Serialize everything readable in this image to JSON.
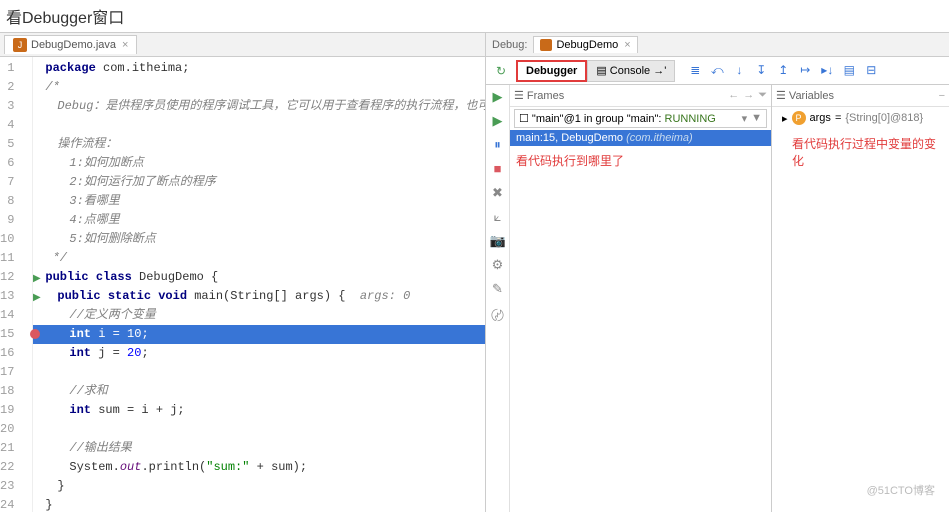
{
  "pageTitle": "看Debugger窗口",
  "editor": {
    "tab": "DebugDemo.java",
    "lines": [
      {
        "n": 1,
        "cls": "",
        "html": "<span class='kw'>package</span> com.itheima;"
      },
      {
        "n": 2,
        "cls": "",
        "html": "<span class='cm'>/*</span>"
      },
      {
        "n": 3,
        "cls": "l2",
        "html": "<span class='cm'>Debug：是供程序员使用的程序调试工具，它可以用于查看程序的执行流程，也可以用-</span>"
      },
      {
        "n": 4,
        "cls": "",
        "html": ""
      },
      {
        "n": 5,
        "cls": "l2",
        "html": "<span class='cm'>操作流程：</span>"
      },
      {
        "n": 6,
        "cls": "l3",
        "html": "<span class='cm'>1:如何加断点</span>"
      },
      {
        "n": 7,
        "cls": "l3",
        "html": "<span class='cm'>2:如何运行加了断点的程序</span>"
      },
      {
        "n": 8,
        "cls": "l3",
        "html": "<span class='cm'>3:看哪里</span>"
      },
      {
        "n": 9,
        "cls": "l3",
        "html": "<span class='cm'>4:点哪里</span>"
      },
      {
        "n": 10,
        "cls": "l3",
        "html": "<span class='cm'>5:如何删除断点</span>"
      },
      {
        "n": 11,
        "cls": "",
        "html": "<span class='cm'> */</span>"
      },
      {
        "n": 12,
        "cls": "",
        "html": "<span class='kw'>public class</span> DebugDemo {",
        "run": true
      },
      {
        "n": 13,
        "cls": "l2",
        "html": "<span class='kw'>public static void</span> main(String[] args) {  <span class='it'>args: 0</span>",
        "run": true
      },
      {
        "n": 14,
        "cls": "l3",
        "html": "<span class='cm'>//定义两个变量</span>"
      },
      {
        "n": 15,
        "cls": "l3",
        "html": "<span class='kw'>int</span> i = <span class='nm'>10</span>;",
        "hl": true,
        "bp": true
      },
      {
        "n": 16,
        "cls": "l3",
        "html": "<span class='kw'>int</span> j = <span class='nm'>20</span>;"
      },
      {
        "n": 17,
        "cls": "",
        "html": ""
      },
      {
        "n": 18,
        "cls": "l3",
        "html": "<span class='cm'>//求和</span>"
      },
      {
        "n": 19,
        "cls": "l3",
        "html": "<span class='kw'>int</span> sum = i + j;"
      },
      {
        "n": 20,
        "cls": "",
        "html": ""
      },
      {
        "n": 21,
        "cls": "l3",
        "html": "<span class='cm'>//输出结果</span>"
      },
      {
        "n": 22,
        "cls": "l3",
        "html": "System.<span class='sf'>out</span>.println(<span class='str'>\"sum:\"</span> + sum);"
      },
      {
        "n": 23,
        "cls": "l2",
        "html": "}"
      },
      {
        "n": 24,
        "cls": "",
        "html": "}"
      }
    ]
  },
  "debug": {
    "label": "Debug:",
    "config": "DebugDemo",
    "tabs": {
      "debugger": "Debugger",
      "console": "Console"
    },
    "framesTitle": "Frames",
    "variablesTitle": "Variables",
    "threadText": "\"main\"@1 in group \"main\":",
    "threadStatus": "RUNNING",
    "frame": {
      "loc": "main:15, DebugDemo",
      "pkg": "(com.itheima)"
    },
    "annotationFrames": "看代码执行到哪里了",
    "annotationVars": "看代码执行过程中变量的变化",
    "varEntry": {
      "name": "args",
      "value": "{String[0]@818}"
    }
  },
  "leftIcons": [
    "▶",
    "▶",
    "⏸",
    "■",
    "✖",
    "⟀",
    "📷",
    "⚙",
    "✎",
    "〄"
  ],
  "stepIcons": [
    "≣",
    "⤺",
    "↓",
    "↧",
    "↥",
    "↦",
    "▸↓",
    "▤",
    "⊟"
  ],
  "watermark": "@51CTO博客"
}
